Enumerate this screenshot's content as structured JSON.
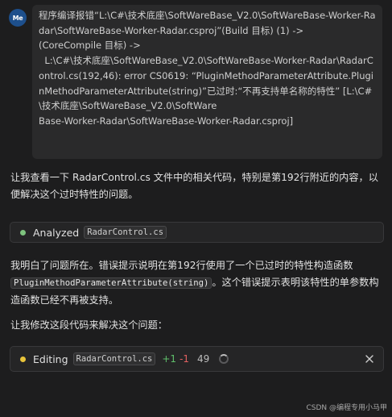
{
  "user": {
    "avatar_text": "Me",
    "message": "程序编译报错“L:\\C#\\技术底座\\SoftWareBase_V2.0\\SoftWareBase-Worker-Radar\\SoftWareBase-Worker-Radar.csproj”(Build 目标) (1) ->\n(CoreCompile 目标) ->\n  L:\\C#\\技术底座\\SoftWareBase_V2.0\\SoftWareBase-Worker-Radar\\RadarControl.cs(192,46): error CS0619: “PluginMethodParameterAttribute.PluginMethodParameterAttribute(string)”已过时:“不再支持单名称的特性” [L:\\C#\\技术底座\\SoftWareBase_V2.0\\SoftWare\nBase-Worker-Radar\\SoftWareBase-Worker-Radar.csproj]"
  },
  "assistant": {
    "para1": "让我查看一下 RadarControl.cs 文件中的相关代码，特别是第192行附近的内容，以便解决这个过时特性的问题。",
    "analyzed": {
      "label": "Analyzed",
      "file": "RadarControl.cs"
    },
    "para2_before": "我明白了问题所在。错误提示说明在第192行使用了一个已过时的特性构造函数 ",
    "para2_code": "PluginMethodParameterAttribute(string)",
    "para2_after": "。这个错误提示表明该特性的单参数构造函数已经不再被支持。",
    "para3": "让我修改这段代码来解决这个问题：",
    "editing": {
      "label": "Editing",
      "file": "RadarControl.cs",
      "added": "+1",
      "removed": "-1",
      "count": "49"
    }
  },
  "watermark": "CSDN @编程专用小马甲",
  "colors": {
    "analyzed_dot": "#7ec37e",
    "editing_dot": "#e8c43a",
    "avatar_bg": "#1d4f8c"
  },
  "icons": [
    "spinner-icon",
    "close-icon"
  ]
}
